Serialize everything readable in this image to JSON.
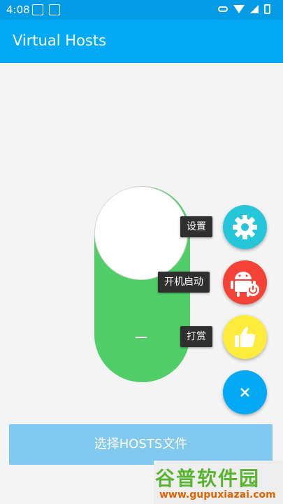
{
  "status_bar": {
    "time": "4:08",
    "icons": [
      "notification-icon",
      "screenshot-icon",
      "key-icon",
      "wifi-icon",
      "signal-icon",
      "battery-icon"
    ]
  },
  "app_bar": {
    "title": "Virtual Hosts",
    "color": "#03a9f4"
  },
  "switch": {
    "state": "on",
    "off_symbol": "—",
    "track_color": "#52ce69"
  },
  "fab_menu": {
    "items": [
      {
        "label": "设置",
        "icon": "gear-icon",
        "color": "#26c6da"
      },
      {
        "label": "开机启动",
        "icon": "android-power-icon",
        "color": "#f44336"
      },
      {
        "label": "打赏",
        "icon": "thumbs-up-icon",
        "color": "#ffeb3b"
      }
    ],
    "close_symbol": "×",
    "close_color": "#03a9f4"
  },
  "main_button": {
    "label": "选择HOSTS文件"
  },
  "watermark": {
    "logo": "谷普软件园",
    "url": "www.gupuxiazai.com"
  }
}
